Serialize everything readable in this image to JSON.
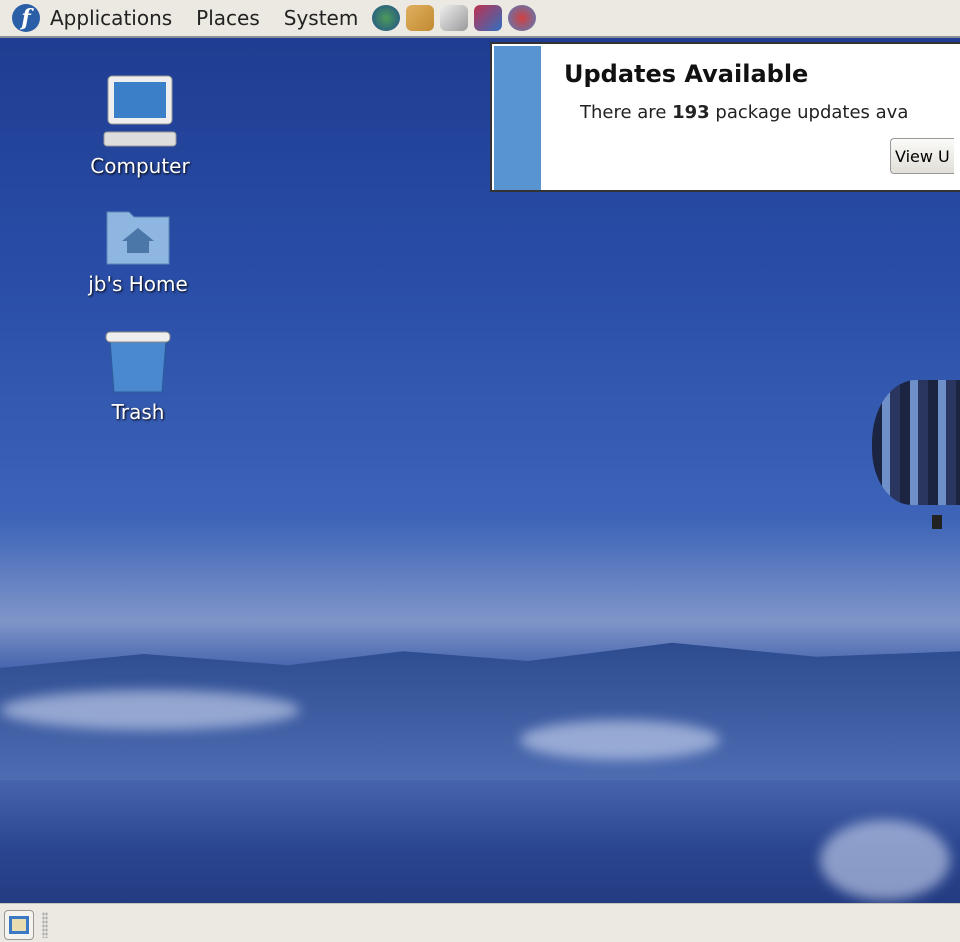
{
  "panel": {
    "menus": [
      "Applications",
      "Places",
      "System"
    ],
    "launchers": [
      "web-browser-icon",
      "mail-icon",
      "notes-icon",
      "office-icon",
      "presentation-icon"
    ]
  },
  "desktop": {
    "icons": [
      {
        "label": "Computer"
      },
      {
        "label": "jb's Home"
      },
      {
        "label": "Trash"
      }
    ]
  },
  "notification": {
    "title": "Updates Available",
    "text_before": "There are ",
    "count": "193",
    "text_after": " package updates ava",
    "button": "View U",
    "accent": "#5894d0"
  }
}
